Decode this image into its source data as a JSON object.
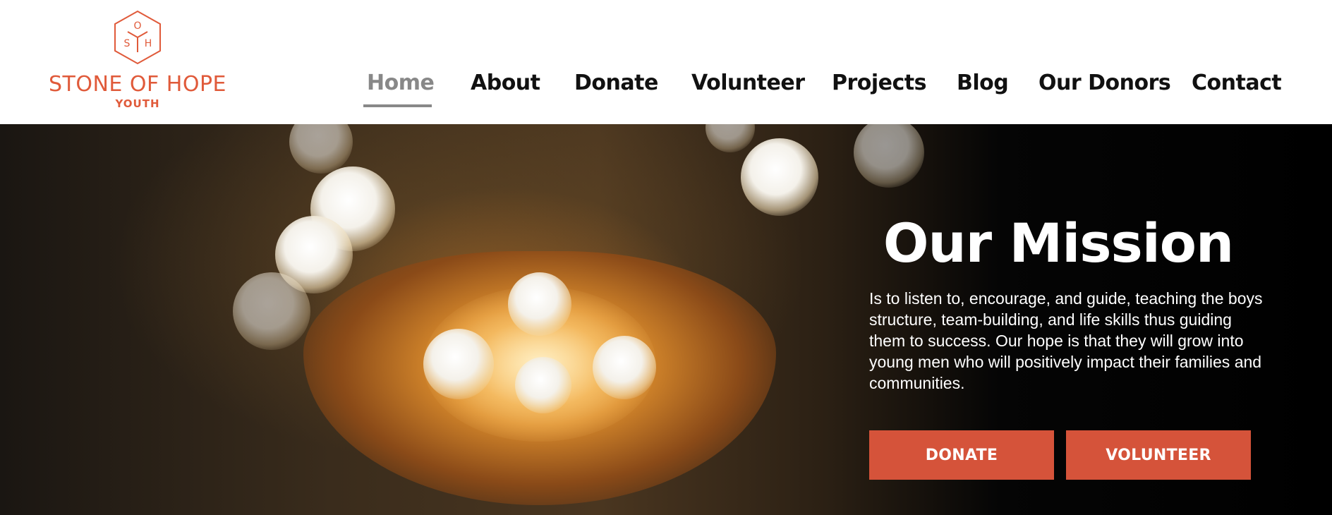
{
  "brand": {
    "logo_letters": [
      "O",
      "S",
      "H"
    ],
    "name": "STONE OF HOPE",
    "subtitle": "YOUTH",
    "color": "#e05a3a"
  },
  "nav": {
    "items": [
      {
        "label": "Home",
        "active": true
      },
      {
        "label": "About",
        "active": false
      },
      {
        "label": "Donate",
        "active": false
      },
      {
        "label": "Volunteer",
        "active": false
      },
      {
        "label": "Projects",
        "active": false
      },
      {
        "label": "Blog",
        "active": false
      },
      {
        "label": "Our Donors",
        "active": false
      },
      {
        "label": "Contact",
        "active": false
      }
    ],
    "active_color": "#888888",
    "text_color": "#111111"
  },
  "hero": {
    "image": "hands-holding-glowing-string-lights",
    "title": "Our Mission",
    "text": "Is to listen to, encourage, and guide, teaching the boys structure, team-building, and life skills thus guiding them to success. Our hope is that they will grow into young men who will positively impact their families and communities.",
    "buttons": {
      "donate": "DONATE",
      "volunteer": "VOLUNTEER"
    },
    "button_color": "#d5533a"
  }
}
